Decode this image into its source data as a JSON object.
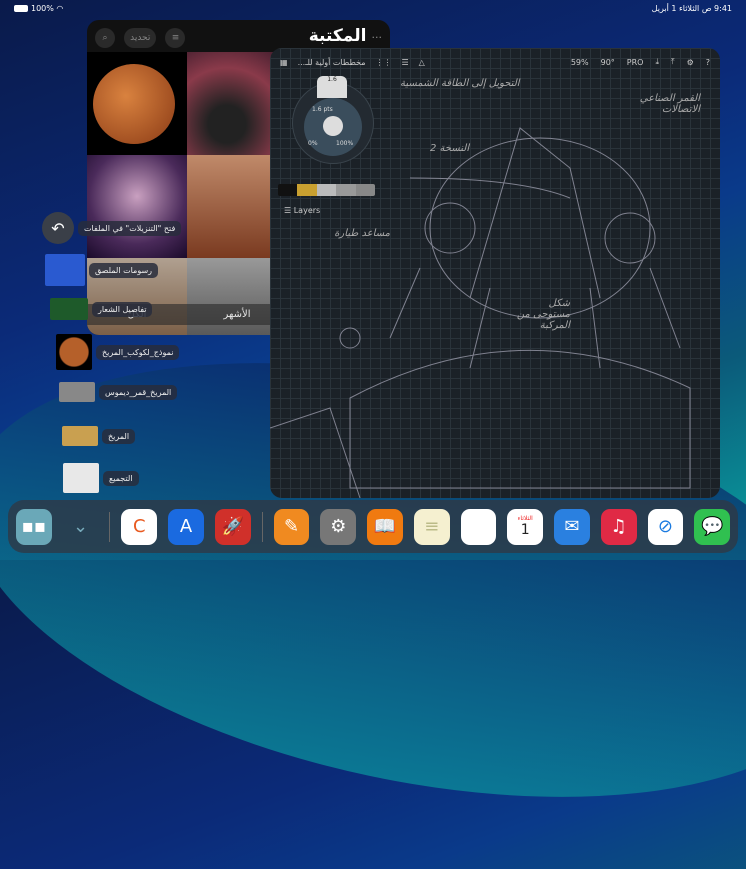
{
  "status": {
    "battery": "100%",
    "time_date": "9:41 ص  الثلاثاء 1 أبريل"
  },
  "library": {
    "title": "المكتبة",
    "more": "···",
    "select_label": "تحديد",
    "tiles": [
      {
        "caption": ""
      },
      {
        "caption": ""
      },
      {
        "caption": ""
      },
      {
        "caption": ""
      },
      {
        "caption": "الكل"
      },
      {
        "caption": "الأشهر"
      }
    ]
  },
  "canvas": {
    "doc_title": "مخططات أولية للـ...",
    "zoom": "59%",
    "rotation": "90°",
    "pro": "PRO",
    "brush_size": "1.6 pts",
    "brush_tip": "1.6",
    "opacity_min": "0%",
    "opacity_max": "100%",
    "layers": "Layers",
    "notes": [
      "التحويل إلى الطاقة الشمسية",
      "النسخة 2",
      "القمر الصناعي الاتصالات",
      "مساعد طيارة",
      "شكل مستوحى من المركبة"
    ]
  },
  "drag_items": [
    {
      "label": "فتح \"التنزيلات\" في الملفات",
      "icon": "back-arrow-icon"
    },
    {
      "label": "رسومات الملصق",
      "color": "#2a5ad0"
    },
    {
      "label": "تفاصيل الشعار",
      "color": "#1e5a2a"
    },
    {
      "label": "نموذج_لكوكب_المريخ",
      "color": "#b5602a"
    },
    {
      "label": "المريخ_قمر_ديموس",
      "color": "#888888"
    },
    {
      "label": "المريخ",
      "color": "#c9a050"
    },
    {
      "label": "التجميع",
      "color": "#e8e8e8"
    }
  ],
  "dock": {
    "calendar_day": "الثلاثاء",
    "calendar_date": "1",
    "apps": [
      "concepts",
      "app-store",
      "rocket",
      "pages",
      "settings",
      "books",
      "notes",
      "photos",
      "calendar",
      "mail",
      "music",
      "safari",
      "messages"
    ]
  }
}
